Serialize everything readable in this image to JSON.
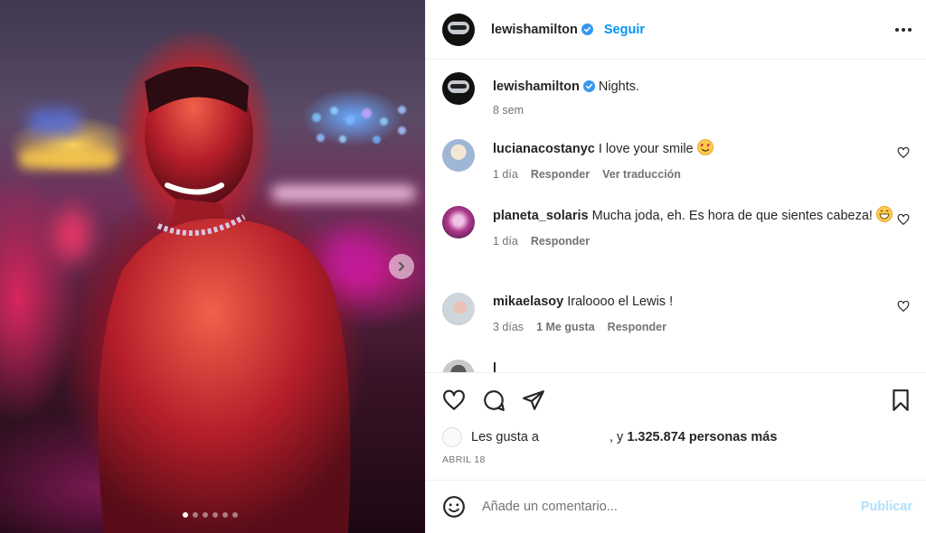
{
  "post": {
    "author": "lewishamilton",
    "follow_label": "Seguir",
    "caption": "Nights.",
    "caption_age": "8 sem",
    "image_position": "1 of 6"
  },
  "comments": [
    {
      "user": "lucianacostanyc",
      "text": "I love your smile",
      "emoji": "smiling-face-with-heart-eyes",
      "age": "1 día",
      "reply": "Responder",
      "translate": "Ver traducción"
    },
    {
      "user": "planeta_solaris",
      "text": "Mucha joda, eh. Es hora de que sientes cabeza!",
      "emoji": "grinning-face",
      "age": "1 día",
      "reply": "Responder"
    },
    {
      "user": "mikaelasoy",
      "text": "Iraloooo el Lewis !",
      "age": "3 días",
      "likes": "1 Me gusta",
      "reply": "Responder"
    },
    {
      "user": "l",
      "text": ""
    }
  ],
  "likes": {
    "prefix": "Les gusta a",
    "suffix": ", y",
    "count_text": "1.325.874 personas más"
  },
  "date": "ABRIL 18",
  "comment_box": {
    "placeholder": "Añade un comentario...",
    "publish_label": "Publicar"
  },
  "colors": {
    "accent": "#0095f6",
    "publish_disabled": "#b2dffc",
    "verified": "#3897f0",
    "muted_text": "#737373"
  }
}
